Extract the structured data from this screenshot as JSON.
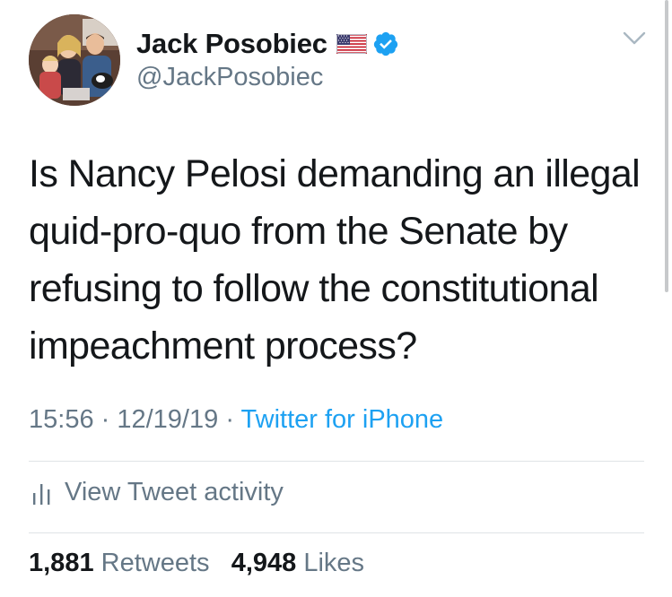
{
  "author": {
    "display_name": "Jack Posobiec",
    "handle": "@JackPosobiec",
    "avatar_icon": "profile-photo-family",
    "flag_icon": "us-flag-emoji",
    "verified_icon": "verified-badge-icon"
  },
  "tweet": {
    "lines": [
      "Is Nancy Pelosi demanding an illegal",
      "quid-pro-quo from the Senate by",
      "refusing to follow the constitutional",
      "impeachment process?"
    ],
    "time": "15:56",
    "date": "12/19/19",
    "separator": "·",
    "source": "Twitter for iPhone"
  },
  "activity": {
    "label": "View Tweet activity",
    "icon": "bar-chart-icon"
  },
  "stats": {
    "retweets_count": "1,881",
    "retweets_label": "Retweets",
    "likes_count": "4,948",
    "likes_label": "Likes"
  },
  "colors": {
    "text_primary": "#14171a",
    "text_secondary": "#657786",
    "link": "#1da1f2",
    "verified": "#1da1f2",
    "divider": "#dfe3e6"
  }
}
